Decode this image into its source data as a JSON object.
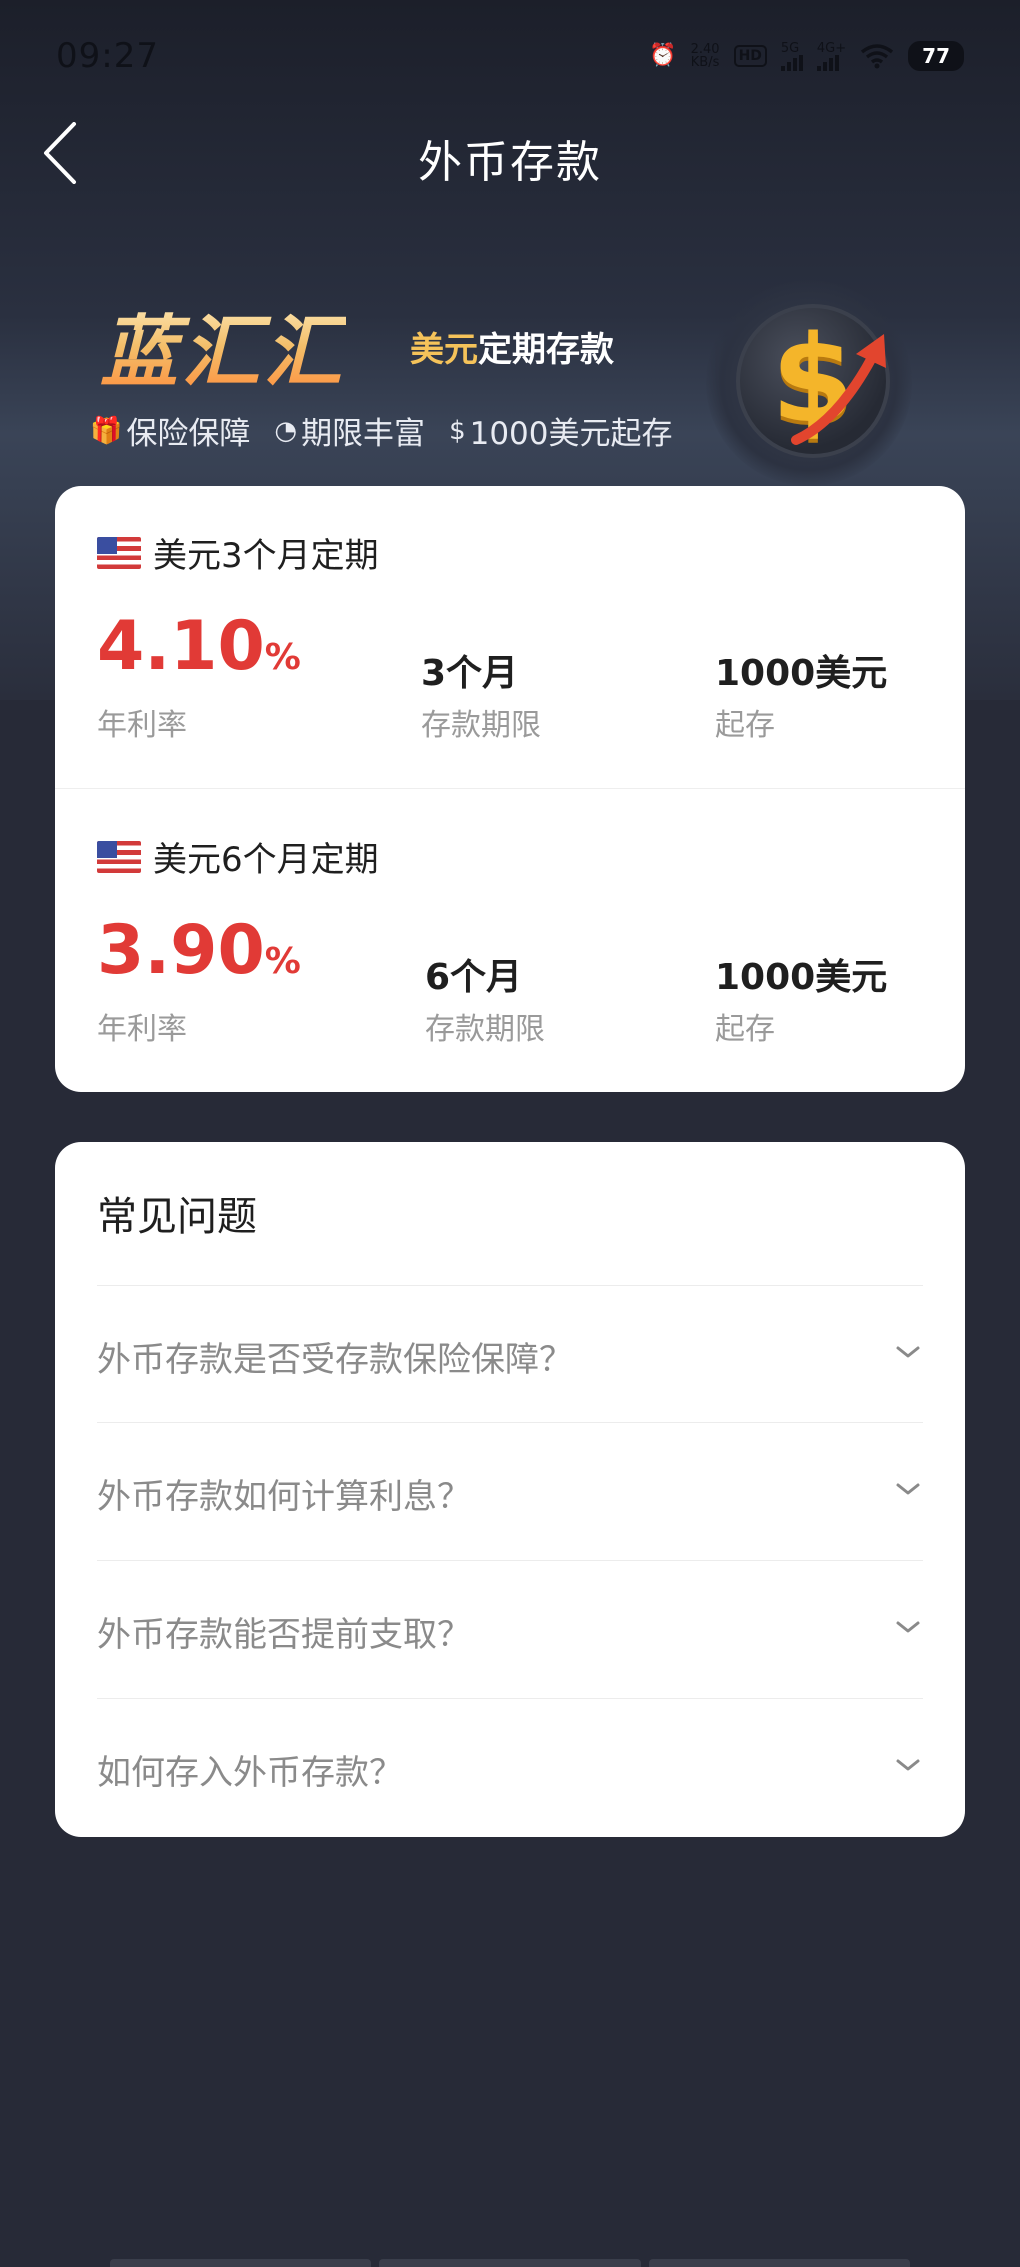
{
  "status_bar": {
    "time": "09:27",
    "net_speed_value": "2.40",
    "net_speed_unit": "KB/s",
    "hd_label": "HD",
    "signal_1": "5G",
    "signal_2": "4G+",
    "battery": "77"
  },
  "header": {
    "title": "外币存款",
    "back_icon": "chevron-left-icon"
  },
  "banner": {
    "brand": "蓝汇汇",
    "subtitle_highlight": "美元",
    "subtitle_rest": "定期存款",
    "features": [
      {
        "icon": "gift-icon",
        "glyph": "🎁",
        "label": "保险保障"
      },
      {
        "icon": "clock-check-icon",
        "glyph": "◔",
        "label": "期限丰富"
      },
      {
        "icon": "dollar-circle-icon",
        "glyph": "$",
        "label": "1000美元起存"
      }
    ],
    "coin_icon": "dollar-coin-icon",
    "coin_symbol": "$"
  },
  "products": [
    {
      "name": "美元3个月定期",
      "flag_icon": "us-flag-icon",
      "rate_value": "4.10",
      "rate_unit": "%",
      "rate_label": "年利率",
      "term_value": "3个月",
      "term_label": "存款期限",
      "min_value": "1000美元",
      "min_label": "起存"
    },
    {
      "name": "美元6个月定期",
      "flag_icon": "us-flag-icon",
      "rate_value": "3.90",
      "rate_unit": "%",
      "rate_label": "年利率",
      "term_value": "6个月",
      "term_label": "存款期限",
      "min_value": "1000美元",
      "min_label": "起存"
    }
  ],
  "faq": {
    "title": "常见问题",
    "items": [
      {
        "question": "外币存款是否受存款保险保障？"
      },
      {
        "question": "外币存款如何计算利息？"
      },
      {
        "question": "外币存款能否提前支取？"
      },
      {
        "question": "如何存入外币存款？"
      }
    ]
  },
  "colors": {
    "background": "#272a37",
    "rate_red": "#e13a36",
    "card": "#ffffff",
    "brand_gold": "#f5c35a"
  }
}
